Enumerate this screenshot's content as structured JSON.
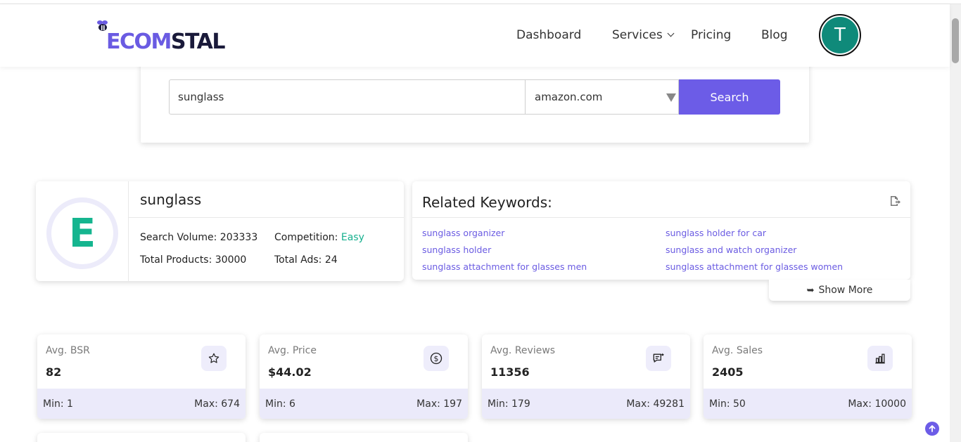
{
  "brand": {
    "logo_part1": "ECOM",
    "logo_part2": "STAL"
  },
  "nav": {
    "dashboard": "Dashboard",
    "services": "Services",
    "pricing": "Pricing",
    "blog": "Blog",
    "avatar_initial": "T"
  },
  "search": {
    "query": "sunglass",
    "marketplace": "amazon.com",
    "button_label": "Search"
  },
  "keyword": {
    "grade": "E",
    "title": "sunglass",
    "search_volume_label": "Search Volume: 203333",
    "competition_label": "Competition: ",
    "competition_value": "Easy",
    "total_products_label": "Total Products: 30000",
    "total_ads_label": "Total Ads: 24"
  },
  "related": {
    "title": "Related Keywords:",
    "items": [
      "sunglass organizer",
      "sunglass holder for car",
      "sunglass holder",
      "sunglass and watch organizer",
      "sunglass attachment for glasses men",
      "sunglass attachment for glasses women"
    ],
    "show_more": "Show More",
    "show_more_arrow": "➥"
  },
  "metrics": [
    {
      "label": "Avg. BSR",
      "value": "82",
      "min": "Min: 1",
      "max": "Max: 674",
      "icon": "star-icon"
    },
    {
      "label": "Avg. Price",
      "value": "$44.02",
      "min": "Min: 6",
      "max": "Max: 197",
      "icon": "dollar-icon"
    },
    {
      "label": "Avg. Reviews",
      "value": "11356",
      "min": "Min: 179",
      "max": "Max: 49281",
      "icon": "review-icon"
    },
    {
      "label": "Avg. Sales",
      "value": "2405",
      "min": "Min: 50",
      "max": "Max: 10000",
      "icon": "chart-icon"
    }
  ],
  "colors": {
    "accent": "#6c5ce7",
    "easy": "#16b08e",
    "avatar": "#0f8a7a"
  }
}
